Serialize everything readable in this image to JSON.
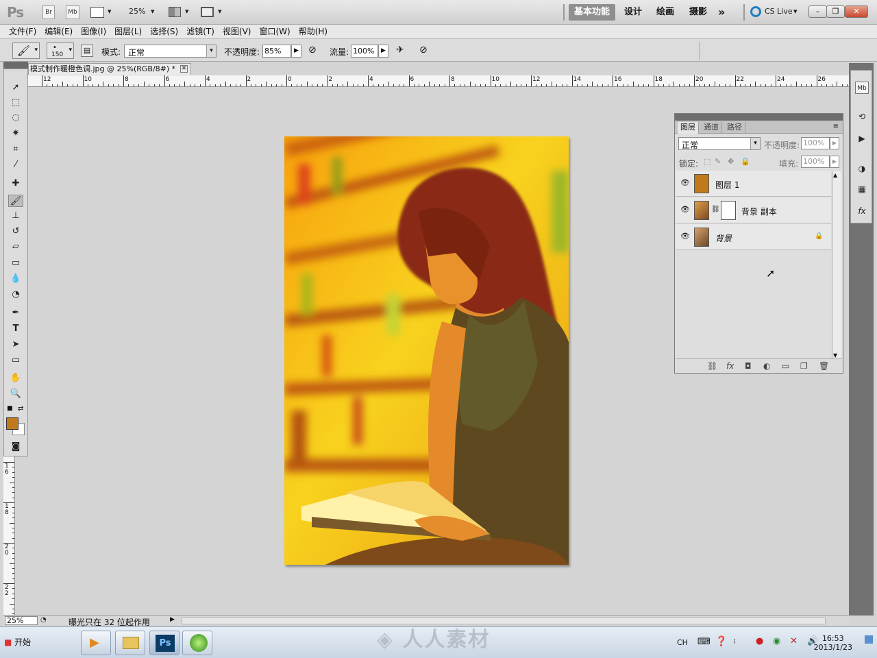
{
  "app": {
    "logo": "Ps",
    "bridge": "Br",
    "mini_bridge": "Mb",
    "zoom": "25%",
    "workspaces": [
      "基本功能",
      "设计",
      "绘画",
      "摄影"
    ],
    "more": "»",
    "cs_live": "CS Live"
  },
  "menu": [
    "文件(F)",
    "编辑(E)",
    "图像(I)",
    "图层(L)",
    "选择(S)",
    "滤镜(T)",
    "视图(V)",
    "窗口(W)",
    "帮助(H)"
  ],
  "options": {
    "brush_size": "150",
    "mode_label": "模式:",
    "mode_value": "正常",
    "opacity_label": "不透明度:",
    "opacity_value": "85%",
    "flow_label": "流量:",
    "flow_value": "100%"
  },
  "document": {
    "tab_title": "模式制作暖橙色调.jpg @ 25%(RGB/8#) *",
    "ruler_top": [
      "12",
      "10",
      "8",
      "6",
      "4",
      "2",
      "0",
      "2",
      "4",
      "6",
      "8",
      "10",
      "12",
      "14",
      "16",
      "18",
      "20",
      "22",
      "24",
      "26"
    ],
    "ruler_left": [
      "1 6",
      "1 8",
      "2 0",
      "2 2"
    ]
  },
  "layers_panel": {
    "tabs": [
      "图层",
      "通道",
      "路径"
    ],
    "blend_mode": "正常",
    "opacity_label": "不透明度:",
    "opacity_value": "100%",
    "lock_label": "锁定:",
    "fill_label": "填充:",
    "fill_value": "100%",
    "layers": [
      {
        "name": "图层 1",
        "color": "#c07a1c"
      },
      {
        "name": "背景 副本"
      },
      {
        "name": "背景"
      }
    ]
  },
  "status": {
    "zoom": "25%",
    "message": "曝光只在 32 位起作用"
  },
  "taskbar": {
    "start": "开始",
    "lang": "CH",
    "time": "16:53",
    "date": "2013/1/23"
  },
  "watermark": "人人素材",
  "colors": {
    "foreground": "#c07a1c",
    "background": "#ffffff",
    "accent_active_workspace": "#8f8f8f"
  }
}
